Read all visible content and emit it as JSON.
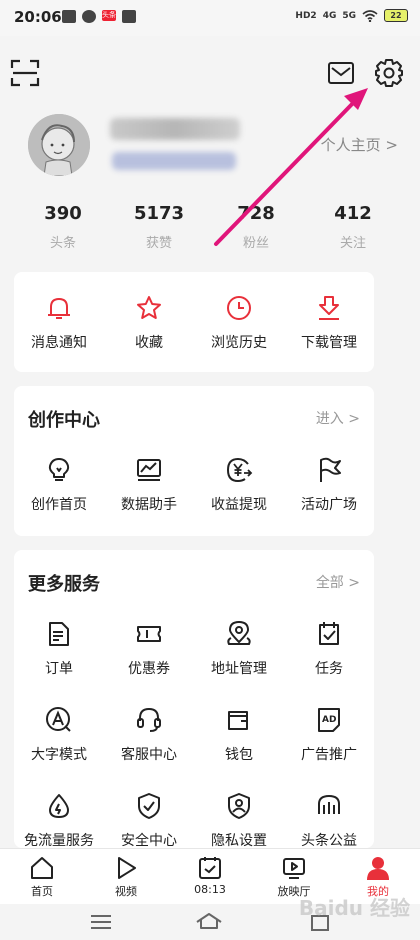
{
  "status_bar": {
    "time": "20:06",
    "tag": "头条",
    "network": [
      "HD2",
      "4G",
      "5G"
    ],
    "battery": "22"
  },
  "header": {
    "scan_icon": "scan-icon",
    "message_icon": "mail-icon",
    "settings_icon": "gear-icon"
  },
  "profile": {
    "homepage_label": "个人主页 >"
  },
  "stats": [
    {
      "value": "390",
      "label": "头条"
    },
    {
      "value": "5173",
      "label": "获赞"
    },
    {
      "value": "728",
      "label": "粉丝"
    },
    {
      "value": "412",
      "label": "关注"
    }
  ],
  "quick": [
    {
      "label": "消息通知",
      "icon": "bell-icon"
    },
    {
      "label": "收藏",
      "icon": "star-icon"
    },
    {
      "label": "浏览历史",
      "icon": "clock-icon"
    },
    {
      "label": "下载管理",
      "icon": "download-icon"
    }
  ],
  "creator": {
    "title": "创作中心",
    "more": "进入 >",
    "items": [
      {
        "label": "创作首页",
        "icon": "bulb-icon"
      },
      {
        "label": "数据助手",
        "icon": "chart-icon"
      },
      {
        "label": "收益提现",
        "icon": "yen-icon"
      },
      {
        "label": "活动广场",
        "icon": "flag-icon"
      }
    ]
  },
  "services": {
    "title": "更多服务",
    "more": "全部 >",
    "items": [
      {
        "label": "订单",
        "icon": "document-icon"
      },
      {
        "label": "优惠券",
        "icon": "ticket-icon"
      },
      {
        "label": "地址管理",
        "icon": "location-icon"
      },
      {
        "label": "任务",
        "icon": "task-icon"
      },
      {
        "label": "大字模式",
        "icon": "font-size-icon"
      },
      {
        "label": "客服中心",
        "icon": "headset-icon"
      },
      {
        "label": "钱包",
        "icon": "wallet-icon"
      },
      {
        "label": "广告推广",
        "icon": "ad-icon"
      },
      {
        "label": "免流量服务",
        "icon": "drop-icon"
      },
      {
        "label": "安全中心",
        "icon": "shield-icon"
      },
      {
        "label": "隐私设置",
        "icon": "privacy-icon"
      },
      {
        "label": "头条公益",
        "icon": "charity-icon"
      }
    ]
  },
  "bottom_nav": [
    {
      "label": "首页",
      "icon": "home-icon"
    },
    {
      "label": "视频",
      "icon": "play-icon"
    },
    {
      "label": "08:13",
      "icon": "clock-task-icon"
    },
    {
      "label": "放映厅",
      "icon": "tv-icon"
    },
    {
      "label": "我的",
      "icon": "user-icon",
      "active": true
    }
  ],
  "colors": {
    "accent": "#e8303a",
    "arrow": "#e0157a",
    "background": "#f4f4f4"
  },
  "watermark": "Baidu 经验"
}
